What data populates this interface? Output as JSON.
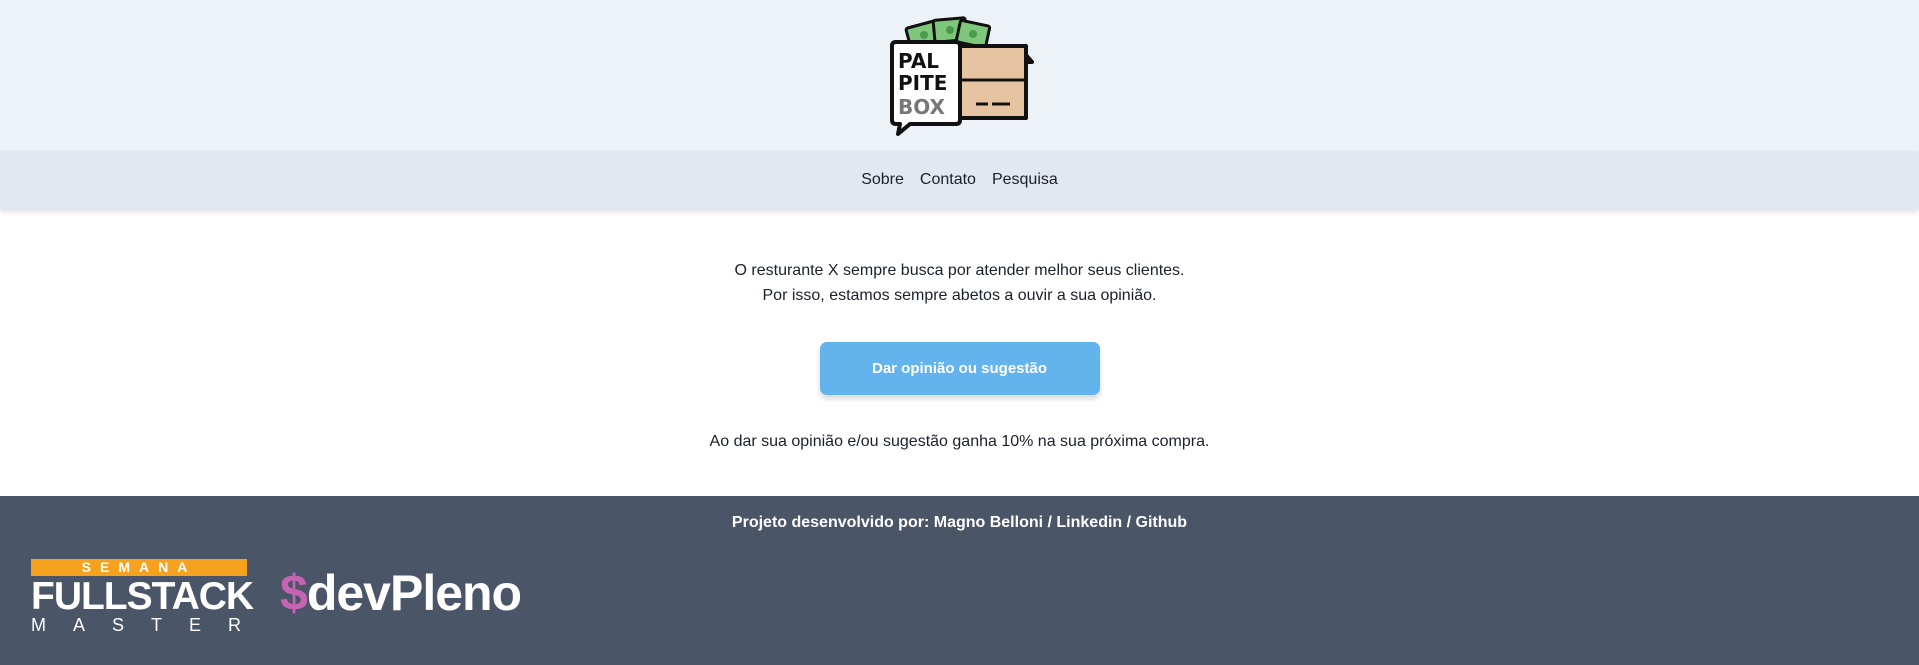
{
  "logo": {
    "lines": [
      "PAL",
      "PITE",
      "BOX"
    ]
  },
  "nav": {
    "items": [
      "Sobre",
      "Contato",
      "Pesquisa"
    ]
  },
  "main": {
    "intro_line1": "O resturante X sempre busca por atender melhor seus clientes.",
    "intro_line2": "Por isso, estamos sempre abetos a ouvir a sua opinião.",
    "cta_label": "Dar opinião ou sugestão",
    "discount_text": "Ao dar sua opinião e/ou sugestão ganha 10% na sua próxima compra."
  },
  "footer": {
    "credits_prefix": "Projeto desenvolvido por: ",
    "author": "Magno Belloni",
    "sep1": " / ",
    "linkedin": "Linkedin",
    "sep2": " / ",
    "github": "Github",
    "fsm_top": "SEMANA",
    "fsm_mid": "FULLSTACK",
    "fsm_bot": "MASTER",
    "devpleno_dollar": "$",
    "devpleno_text": "devPleno"
  },
  "colors": {
    "header_bg": "#edf2f7",
    "nav_bg": "#e2e8f0",
    "cta_bg": "#63b3ed",
    "footer_bg": "#4a5568",
    "fsm_accent": "#f6a21e",
    "devpleno_accent": "#c763b3"
  }
}
